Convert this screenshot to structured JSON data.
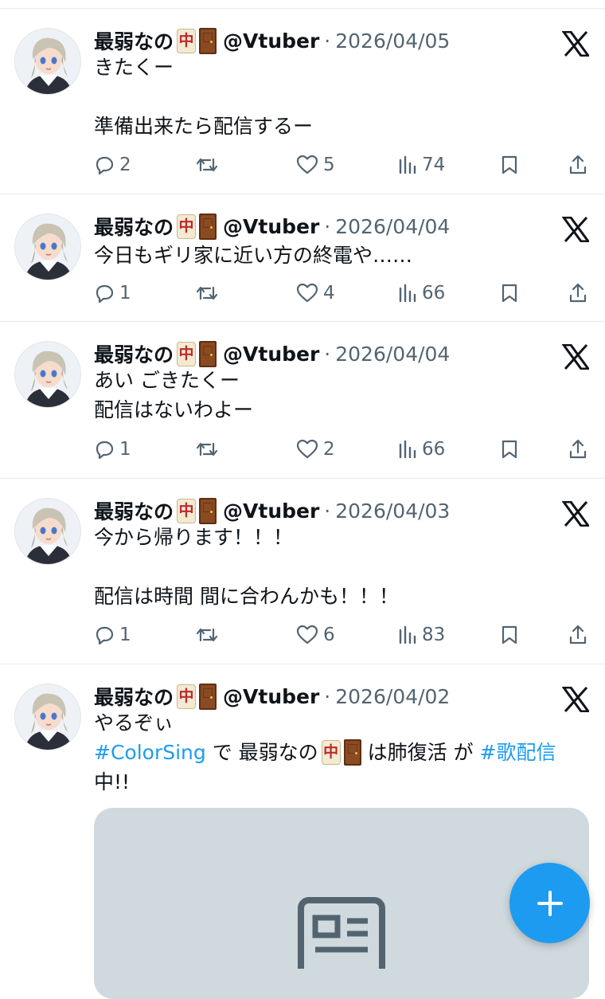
{
  "author": {
    "display_name": "最弱なの",
    "name_emoji_1": "中",
    "name_emoji_2": "door-emoji",
    "handle": "@Vtuber",
    "separator": "·"
  },
  "tweets": [
    {
      "date": "2026/04/05",
      "lines": [
        "きたくー",
        "",
        "準備出来たら配信するー"
      ],
      "replies": "2",
      "retweets": "",
      "likes": "5",
      "views": "74"
    },
    {
      "date": "2026/04/04",
      "lines": [
        "今日もギリ家に近い方の終電や……"
      ],
      "replies": "1",
      "retweets": "",
      "likes": "4",
      "views": "66"
    },
    {
      "date": "2026/04/04",
      "lines": [
        "あい ごきたくー",
        "配信はないわよー"
      ],
      "replies": "1",
      "retweets": "",
      "likes": "2",
      "views": "66"
    },
    {
      "date": "2026/04/03",
      "lines": [
        "今から帰ります！！！",
        "",
        "配信は時間 間に合わんかも！！！"
      ],
      "replies": "1",
      "retweets": "",
      "likes": "6",
      "views": "83"
    },
    {
      "date": "2026/04/02",
      "line1": "やるぞぃ",
      "hashtag1": "#ColorSing",
      "text_de": " で ",
      "text_name": "最弱なの",
      "text_after": " は肺復活 が ",
      "hashtag2": "#歌配信",
      "line3": "中!!"
    }
  ],
  "icons": {
    "reply": "reply-icon",
    "retweet": "retweet-icon",
    "like": "heart-icon",
    "views": "views-icon",
    "bookmark": "bookmark-icon",
    "share": "share-icon",
    "platform": "x-logo-icon",
    "compose": "plus-icon"
  },
  "colors": {
    "text": "#0f1419",
    "secondary": "#536471",
    "link": "#1d9bf0",
    "fab": "#1d9bf0",
    "divider": "#e6e9ec",
    "card": "#cfd9de"
  }
}
